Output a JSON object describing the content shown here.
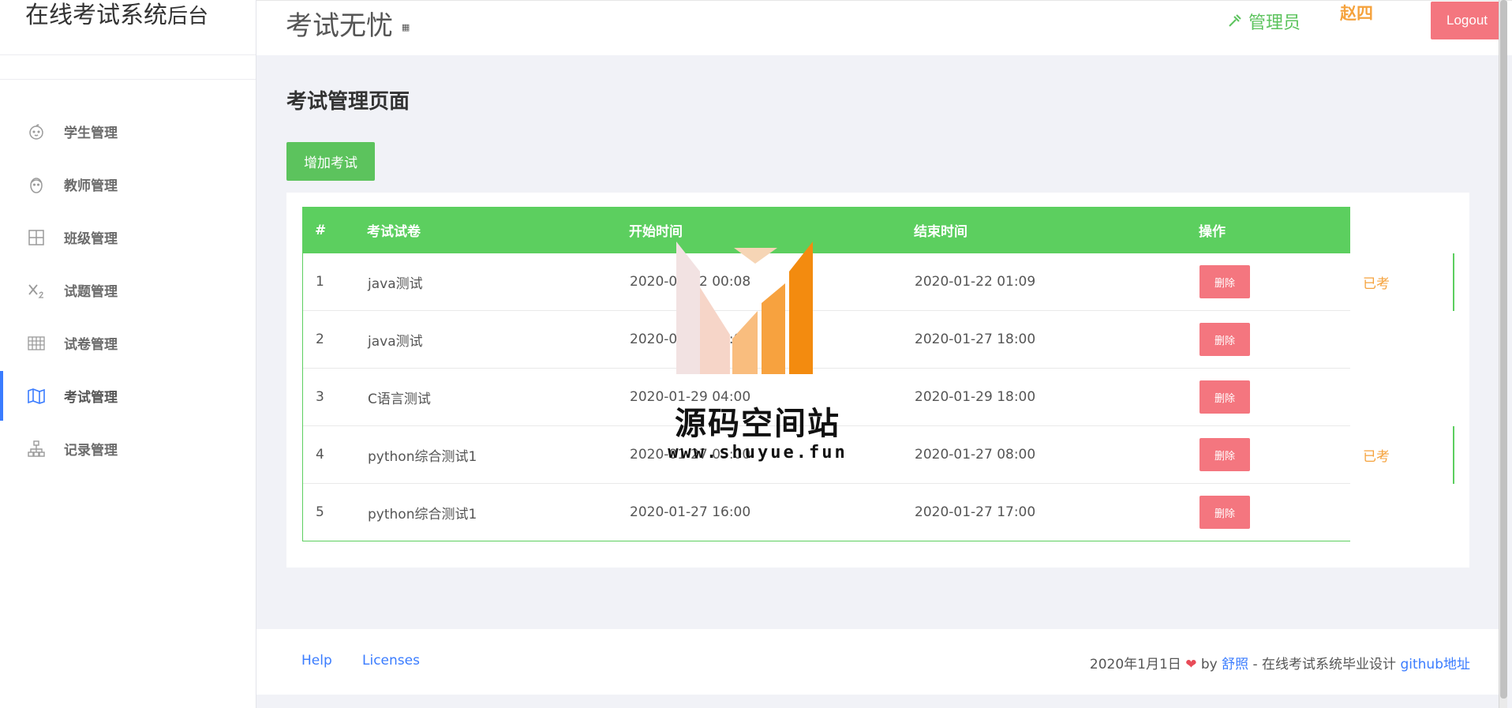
{
  "sidebar": {
    "brand_main": "在线考试系统",
    "brand_small": "后台",
    "items": [
      {
        "label": "学生管理",
        "icon": "baby-face-icon"
      },
      {
        "label": "教师管理",
        "icon": "face-icon"
      },
      {
        "label": "班级管理",
        "icon": "grid-icon"
      },
      {
        "label": "试题管理",
        "icon": "subscript-x-icon"
      },
      {
        "label": "试卷管理",
        "icon": "table-icon"
      },
      {
        "label": "考试管理",
        "icon": "map-icon",
        "active": true
      },
      {
        "label": "记录管理",
        "icon": "sitemap-icon"
      }
    ]
  },
  "header": {
    "title": "考试无忧",
    "title_badge": "▦",
    "role": "管理员",
    "username": "赵四",
    "logout_label": "Logout"
  },
  "main": {
    "page_title": "考试管理页面",
    "add_button_label": "增加考试",
    "table": {
      "headers": [
        "#",
        "考试试卷",
        "开始时间",
        "结束时间",
        "操作"
      ],
      "rows": [
        {
          "num": "1",
          "paper": "java测试",
          "start": "2020-01-22 00:08",
          "end": "2020-01-22 01:09",
          "action": "删除",
          "status": "已考"
        },
        {
          "num": "2",
          "paper": "java测试",
          "start": "2020-01-27 15:00",
          "end": "2020-01-27 18:00",
          "action": "删除",
          "status": ""
        },
        {
          "num": "3",
          "paper": "C语言测试",
          "start": "2020-01-29 04:00",
          "end": "2020-01-29 18:00",
          "action": "删除",
          "status": ""
        },
        {
          "num": "4",
          "paper": "python综合测试1",
          "start": "2020-01-27 05:00",
          "end": "2020-01-27 08:00",
          "action": "删除",
          "status": "已考"
        },
        {
          "num": "5",
          "paper": "python综合测试1",
          "start": "2020-01-27 16:00",
          "end": "2020-01-27 17:00",
          "action": "删除",
          "status": ""
        }
      ]
    }
  },
  "watermark": {
    "text": "源码空间站",
    "url": "www.shuyue.fun"
  },
  "footer": {
    "help": "Help",
    "licenses": "Licenses",
    "date": "2020年1月1日",
    "by": "by",
    "author": "舒照",
    "desc": " - 在线考试系统毕业设计 ",
    "github": "github地址"
  },
  "colors": {
    "green": "#5cc35d",
    "header_green": "#5ccf5f",
    "red": "#f4767f",
    "orange": "#f5a23c",
    "blue": "#3a7cff"
  }
}
